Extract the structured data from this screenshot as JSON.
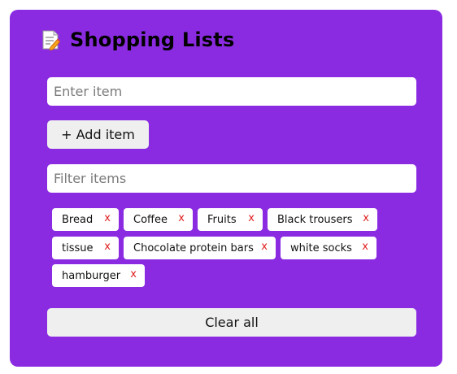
{
  "app": {
    "title": "Shopping Lists",
    "icon": "memo-icon"
  },
  "item_input": {
    "placeholder": "Enter item",
    "value": ""
  },
  "add_button": {
    "label": "+ Add item"
  },
  "filter_input": {
    "placeholder": "Filter items",
    "value": ""
  },
  "items": [
    {
      "label": "Bread",
      "remove": "x"
    },
    {
      "label": "Coffee",
      "remove": "x"
    },
    {
      "label": "Fruits",
      "remove": "x"
    },
    {
      "label": "Black trousers",
      "remove": "x"
    },
    {
      "label": "tissue",
      "remove": "x"
    },
    {
      "label": "Chocolate protein bars",
      "remove": "x"
    },
    {
      "label": "white socks",
      "remove": "x"
    },
    {
      "label": "hamburger",
      "remove": "x"
    }
  ],
  "clear_button": {
    "label": "Clear all"
  },
  "colors": {
    "panel": "#8a2be2",
    "remove": "#e02020",
    "button": "#efefef"
  }
}
